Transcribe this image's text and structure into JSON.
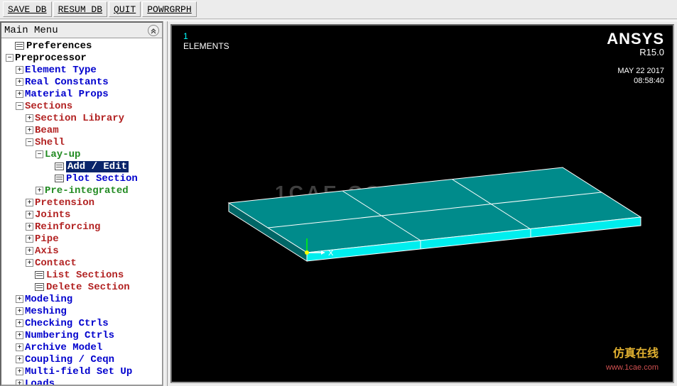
{
  "toolbar": {
    "save_db": "SAVE_DB",
    "resum_db": "RESUM_DB",
    "quit": "QUIT",
    "powrgrph": "POWRGRPH"
  },
  "sidebar": {
    "title": "Main Menu",
    "items": [
      {
        "indent": 0,
        "exp": "",
        "icon": true,
        "label": "Preferences",
        "color": "c-black"
      },
      {
        "indent": 0,
        "exp": "-",
        "icon": false,
        "label": "Preprocessor",
        "color": "c-black"
      },
      {
        "indent": 1,
        "exp": "+",
        "icon": false,
        "label": "Element Type",
        "color": "c-blue"
      },
      {
        "indent": 1,
        "exp": "+",
        "icon": false,
        "label": "Real Constants",
        "color": "c-blue"
      },
      {
        "indent": 1,
        "exp": "+",
        "icon": false,
        "label": "Material Props",
        "color": "c-blue"
      },
      {
        "indent": 1,
        "exp": "-",
        "icon": false,
        "label": "Sections",
        "color": "c-red"
      },
      {
        "indent": 2,
        "exp": "+",
        "icon": false,
        "label": "Section Library",
        "color": "c-red"
      },
      {
        "indent": 2,
        "exp": "+",
        "icon": false,
        "label": "Beam",
        "color": "c-red"
      },
      {
        "indent": 2,
        "exp": "-",
        "icon": false,
        "label": "Shell",
        "color": "c-red"
      },
      {
        "indent": 3,
        "exp": "-",
        "icon": false,
        "label": "Lay-up",
        "color": "c-green"
      },
      {
        "indent": 4,
        "exp": "",
        "icon": true,
        "label": "Add / Edit",
        "color": "c-blue",
        "selected": true
      },
      {
        "indent": 4,
        "exp": "",
        "icon": true,
        "label": "Plot Section",
        "color": "c-blue"
      },
      {
        "indent": 3,
        "exp": "+",
        "icon": false,
        "label": "Pre-integrated",
        "color": "c-green"
      },
      {
        "indent": 2,
        "exp": "+",
        "icon": false,
        "label": "Pretension",
        "color": "c-red"
      },
      {
        "indent": 2,
        "exp": "+",
        "icon": false,
        "label": "Joints",
        "color": "c-red"
      },
      {
        "indent": 2,
        "exp": "+",
        "icon": false,
        "label": "Reinforcing",
        "color": "c-red"
      },
      {
        "indent": 2,
        "exp": "+",
        "icon": false,
        "label": "Pipe",
        "color": "c-red"
      },
      {
        "indent": 2,
        "exp": "+",
        "icon": false,
        "label": "Axis",
        "color": "c-red"
      },
      {
        "indent": 2,
        "exp": "+",
        "icon": false,
        "label": "Contact",
        "color": "c-red"
      },
      {
        "indent": 2,
        "exp": "",
        "icon": true,
        "label": "List Sections",
        "color": "c-red"
      },
      {
        "indent": 2,
        "exp": "",
        "icon": true,
        "label": "Delete Section",
        "color": "c-red"
      },
      {
        "indent": 1,
        "exp": "+",
        "icon": false,
        "label": "Modeling",
        "color": "c-blue"
      },
      {
        "indent": 1,
        "exp": "+",
        "icon": false,
        "label": "Meshing",
        "color": "c-blue"
      },
      {
        "indent": 1,
        "exp": "+",
        "icon": false,
        "label": "Checking Ctrls",
        "color": "c-blue"
      },
      {
        "indent": 1,
        "exp": "+",
        "icon": false,
        "label": "Numbering Ctrls",
        "color": "c-blue"
      },
      {
        "indent": 1,
        "exp": "+",
        "icon": false,
        "label": "Archive Model",
        "color": "c-blue"
      },
      {
        "indent": 1,
        "exp": "+",
        "icon": false,
        "label": "Coupling / Ceqn",
        "color": "c-blue"
      },
      {
        "indent": 1,
        "exp": "+",
        "icon": false,
        "label": "Multi-field Set Up",
        "color": "c-blue"
      },
      {
        "indent": 1,
        "exp": "+",
        "icon": false,
        "label": "Loads",
        "color": "c-blue"
      }
    ]
  },
  "viewport": {
    "top_number": "1",
    "elements_label": "ELEMENTS",
    "brand": "ANSYS",
    "version": "R15.0",
    "date": "MAY 22 2017",
    "time": "08:58:40",
    "axis_x": "X",
    "watermark_main": "1CAE.COM",
    "watermark_zh": "仿真在线",
    "watermark_url": "www.1cae.com"
  }
}
